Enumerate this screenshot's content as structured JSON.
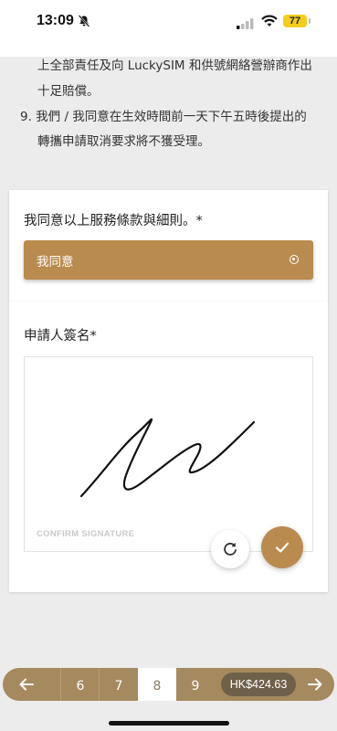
{
  "status": {
    "time": "13:09",
    "battery": "77",
    "icons": [
      "bell-slash-icon",
      "signal-icon",
      "wifi-icon",
      "battery-icon"
    ]
  },
  "terms": {
    "line1": "上全部責任及向 LuckySIM 和供號網絡營辦商作出",
    "line2": "十足賠償。",
    "line3": "9.  我們 / 我同意在生效時間前一天下午五時後提出的",
    "line4": "轉攜申請取消要求將不獲受理。"
  },
  "agreement": {
    "label": "我同意以上服務條款與細則。*",
    "option": "我同意",
    "selected": true
  },
  "signature": {
    "label": "申請人簽名*",
    "hint": "CONFIRM SIGNATURE",
    "reset_icon": "refresh-icon",
    "confirm_icon": "check-icon"
  },
  "pager": {
    "prev_icon": "arrow-left-icon",
    "next_icon": "arrow-right-icon",
    "pages": [
      "6",
      "7",
      "8",
      "9"
    ],
    "current": "8",
    "price": "HK$424.63"
  },
  "colors": {
    "accent": "#b98b4e",
    "pager_bg": "#a58a5f",
    "price_bg": "#6f6049",
    "page_bg": "#ececec"
  }
}
